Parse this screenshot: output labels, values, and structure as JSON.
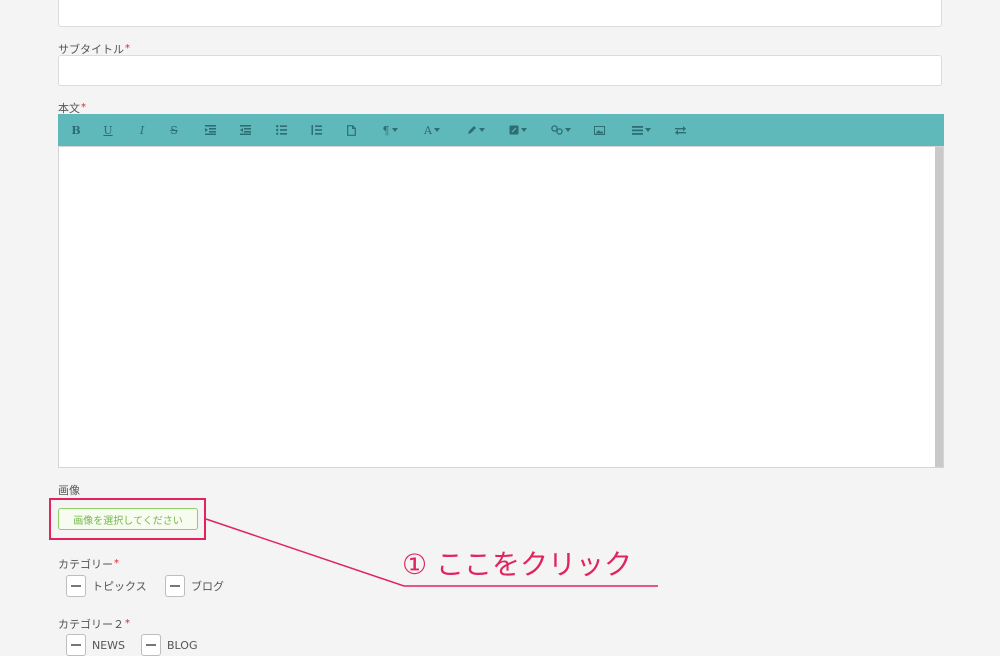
{
  "form": {
    "subtitle_label": "サブタイトル",
    "body_label": "本文",
    "image_label": "画像",
    "select_image_button": "画像を選択してください",
    "category_label": "カテゴリー",
    "category_options": [
      "トピックス",
      "ブログ"
    ],
    "category2_label": "カテゴリー２",
    "category2_options": [
      "NEWS",
      "BLOG"
    ],
    "required_mark": "*"
  },
  "toolbar": {
    "bold": "B",
    "underline": "U",
    "italic": "I",
    "strike": "S",
    "font_color": "A",
    "paragraph": "¶",
    "icons": [
      "bold-icon",
      "underline-icon",
      "italic-icon",
      "strikethrough-icon",
      "outdent-icon",
      "indent-icon",
      "bullet-list-icon",
      "numbered-list-icon",
      "document-icon",
      "paragraph-icon",
      "font-color-icon",
      "highlight-pen-icon",
      "table-icon",
      "link-icon",
      "image-icon",
      "align-icon",
      "swap-icon"
    ]
  },
  "annotation": {
    "text": "① ここをクリック"
  },
  "colors": {
    "toolbar": "#5fb8b9",
    "accent_red": "#e0245e",
    "button_green": "#74b94a"
  }
}
